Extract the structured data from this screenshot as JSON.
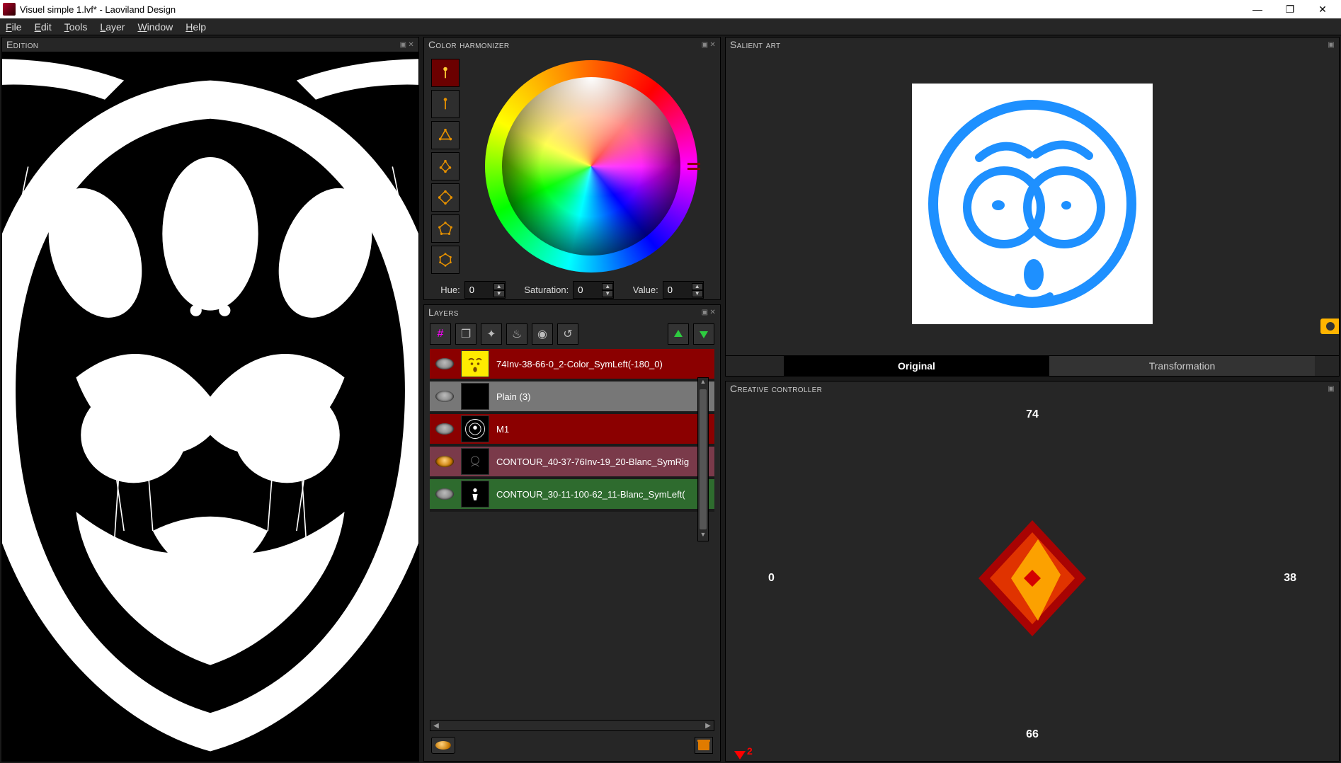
{
  "window": {
    "title": "Visuel simple 1.lvf* - Laoviland Design",
    "minimize": "—",
    "maximize": "❐",
    "close": "✕"
  },
  "menu": {
    "file": "File",
    "edit": "Edit",
    "tools": "Tools",
    "layer": "Layer",
    "window": "Window",
    "help": "Help"
  },
  "panels": {
    "edition": "Edition",
    "harmonizer": "Color harmonizer",
    "layers": "Layers",
    "salient": "Salient art",
    "cc": "Creative controller"
  },
  "harmonizer": {
    "hue_label": "Hue:",
    "sat_label": "Saturation:",
    "val_label": "Value:",
    "hue": "0",
    "sat": "0",
    "val": "0",
    "modes": [
      "single",
      "complementary",
      "triadic",
      "split",
      "square",
      "pentagon",
      "hexagon"
    ]
  },
  "layer_toolbar_icons": [
    "grid",
    "duplicate",
    "merge",
    "flame",
    "sphere",
    "rotate"
  ],
  "layers": [
    {
      "name": "74Inv-38-66-0_2-Color_SymLeft(-180_0)",
      "color": "red",
      "thumb": "yellow-face"
    },
    {
      "name": "Plain (3)",
      "color": "gray",
      "thumb": "black"
    },
    {
      "name": "M1",
      "color": "red",
      "thumb": "abstract"
    },
    {
      "name": "CONTOUR_40-37-76Inv-19_20-Blanc_SymRig",
      "color": "mauve",
      "thumb": "dark1"
    },
    {
      "name": "CONTOUR_30-11-100-62_11-Blanc_SymLeft(",
      "color": "green",
      "thumb": "dark2"
    }
  ],
  "salient": {
    "tab_original": "Original",
    "tab_transformation": "Transformation"
  },
  "cc": {
    "top": "74",
    "right": "38",
    "bottom": "66",
    "left": "0",
    "slider_val": "2"
  }
}
